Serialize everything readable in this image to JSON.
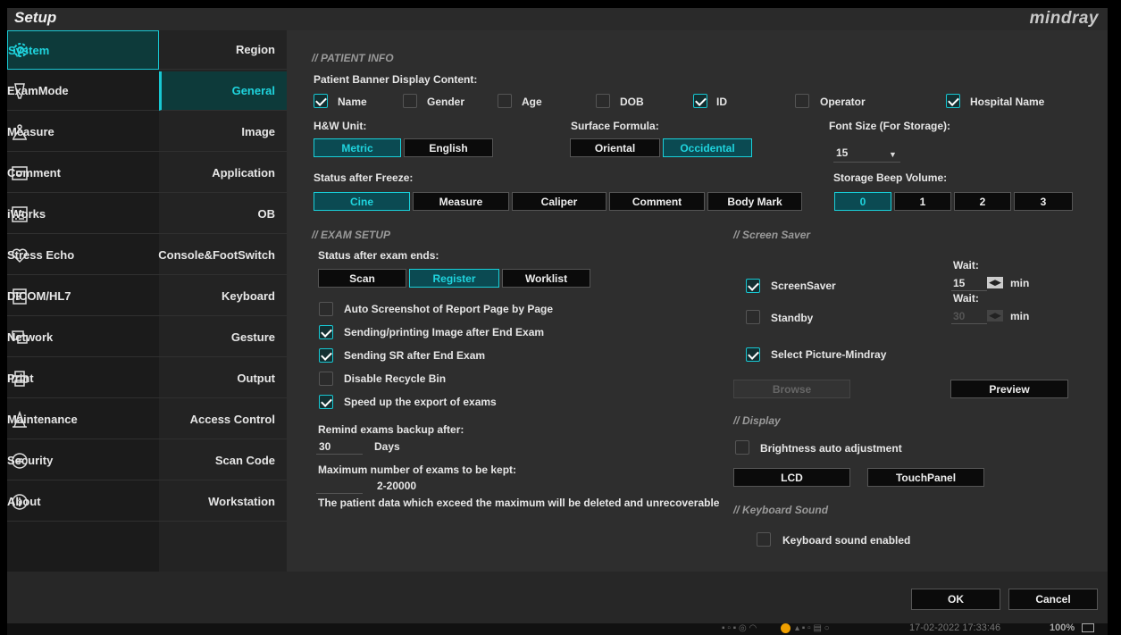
{
  "header": {
    "title": "Setup",
    "brand": "mindray"
  },
  "nav_primary": [
    {
      "label": "System",
      "icon": "gear-icon",
      "active": true
    },
    {
      "label": "ExamMode",
      "icon": "probe-icon"
    },
    {
      "label": "Measure",
      "icon": "measure-icon"
    },
    {
      "label": "Comment",
      "icon": "comment-icon"
    },
    {
      "label": "iWorks",
      "icon": "iworks-icon"
    },
    {
      "label": "Stress Echo",
      "icon": "heart-icon"
    },
    {
      "label": "DICOM/HL7",
      "icon": "dicom-icon"
    },
    {
      "label": "Network",
      "icon": "network-icon"
    },
    {
      "label": "Print",
      "icon": "printer-icon"
    },
    {
      "label": "Maintenance",
      "icon": "maintenance-icon"
    },
    {
      "label": "Security",
      "icon": "shield-icon"
    },
    {
      "label": "About",
      "icon": "info-icon"
    }
  ],
  "nav_secondary": [
    {
      "label": "Region"
    },
    {
      "label": "General",
      "active": true
    },
    {
      "label": "Image"
    },
    {
      "label": "Application"
    },
    {
      "label": "OB"
    },
    {
      "label": "Console&FootSwitch"
    },
    {
      "label": "Keyboard"
    },
    {
      "label": "Gesture"
    },
    {
      "label": "Output"
    },
    {
      "label": "Access Control"
    },
    {
      "label": "Scan Code"
    },
    {
      "label": "Workstation"
    }
  ],
  "patient_info": {
    "section": "PATIENT INFO",
    "banner_label": "Patient Banner Display Content:",
    "banner_items": [
      {
        "label": "Name",
        "checked": true
      },
      {
        "label": "Gender",
        "checked": false
      },
      {
        "label": "Age",
        "checked": false
      },
      {
        "label": "DOB",
        "checked": false
      },
      {
        "label": "ID",
        "checked": true
      },
      {
        "label": "Operator",
        "checked": false
      },
      {
        "label": "Hospital Name",
        "checked": true
      }
    ],
    "hw_unit_label": "H&W Unit:",
    "hw_units": [
      "Metric",
      "English"
    ],
    "surface_label": "Surface Formula:",
    "surface_options": [
      "Oriental",
      "Occidental"
    ],
    "font_size_label": "Font Size (For Storage):",
    "font_size_value": "15",
    "freeze_label": "Status after Freeze:",
    "freeze_options": [
      "Cine",
      "Measure",
      "Caliper",
      "Comment",
      "Body Mark"
    ],
    "beep_label": "Storage Beep Volume:",
    "beep_options": [
      "0",
      "1",
      "2",
      "3"
    ]
  },
  "exam_setup": {
    "section": "EXAM SETUP",
    "status_label": "Status after exam ends:",
    "status_options": [
      "Scan",
      "Register",
      "Worklist"
    ],
    "options": [
      {
        "label": "Auto Screenshot of Report Page by Page",
        "checked": false
      },
      {
        "label": "Sending/printing Image after End Exam",
        "checked": true
      },
      {
        "label": "Sending SR after End Exam",
        "checked": true
      },
      {
        "label": "Disable Recycle Bin",
        "checked": false
      },
      {
        "label": "Speed up the export of exams",
        "checked": true
      }
    ],
    "remind_label": "Remind exams backup after:",
    "remind_value": "30",
    "remind_unit": "Days",
    "max_label": "Maximum number of exams to be kept:",
    "max_range": "2-20000",
    "warning": "The patient data which exceed the maximum will be deleted and unrecoverable"
  },
  "screen_saver": {
    "section": "Screen Saver",
    "screensaver_label": "ScreenSaver",
    "standby_label": "Standby",
    "select_picture_label": "Select Picture-Mindray",
    "wait_label": "Wait:",
    "wait1_value": "15",
    "wait2_value": "30",
    "min_label": "min",
    "browse_label": "Browse",
    "preview_label": "Preview"
  },
  "display": {
    "section": "Display",
    "brightness_label": "Brightness auto adjustment",
    "lcd_label": "LCD",
    "touchpanel_label": "TouchPanel"
  },
  "keyboard_sound": {
    "section": "Keyboard Sound",
    "enabled_label": "Keyboard sound enabled"
  },
  "footer": {
    "ok_label": "OK",
    "cancel_label": "Cancel"
  },
  "taskbar": {
    "datetime": "17-02-2022 17:33:46",
    "zoom": "100%"
  }
}
